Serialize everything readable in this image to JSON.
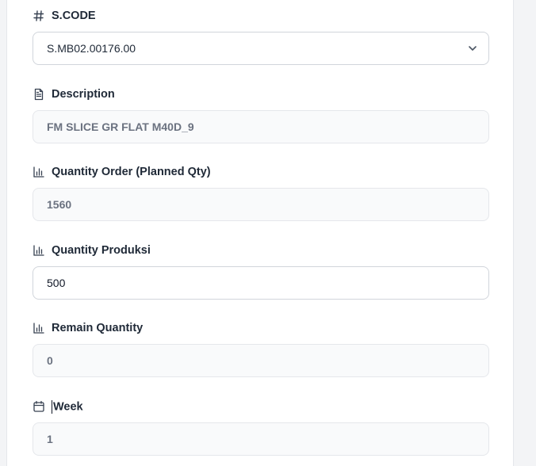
{
  "fields": {
    "scode": {
      "label": "S.CODE",
      "icon": "hash-icon",
      "value": "S.MB02.00176.00",
      "dropdown_icon": "chevron-down-icon"
    },
    "description": {
      "label": "Description",
      "icon": "document-icon",
      "value": "FM SLICE GR FLAT M40D_9"
    },
    "quantity_order": {
      "label": "Quantity Order (Planned Qty)",
      "icon": "bar-chart-icon",
      "value": "1560"
    },
    "quantity_produksi": {
      "label": "Quantity Produksi",
      "icon": "bar-chart-icon",
      "value": "500"
    },
    "remain_quantity": {
      "label": "Remain Quantity",
      "icon": "bar-chart-icon",
      "value": "0"
    },
    "week": {
      "label": "Week",
      "icon": "calendar-icon",
      "value": "1"
    }
  },
  "colors": {
    "panel_bg": "#ffffff",
    "page_bg": "#f3f4f6",
    "readonly_bg": "#f9fafb",
    "border": "#d1d5db",
    "label_text": "#1f2937",
    "readonly_text": "#6b7280"
  }
}
